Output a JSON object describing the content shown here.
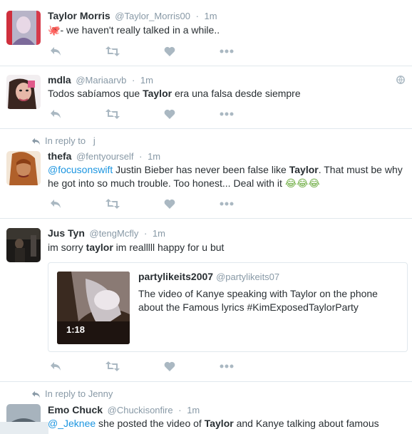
{
  "tweets": [
    {
      "fullname": "Taylor Morris",
      "username": "@Taylor_Morris00",
      "sep": "·",
      "time": "1m",
      "text_emoji": "🐙",
      "text_rest": "- we haven't really talked in a while.."
    },
    {
      "fullname": "mdla",
      "username": "@Mariaarvb",
      "sep": "·",
      "time": "1m",
      "text_a": "Todos sabíamos que ",
      "text_b": "Taylor",
      "text_c": " era una falsa desde siempre"
    },
    {
      "reply_context": "In reply to   j",
      "fullname": "thefa",
      "username": "@fentyourself",
      "sep": "·",
      "time": "1m",
      "mention": "@focusonswift",
      "text_a": " Justin Bieber has never been false like ",
      "text_b": "Taylor",
      "text_c": ". That must be why he got into so much trouble. Too honest... Deal with it ",
      "emoji": "😂😂😂"
    },
    {
      "fullname": "Jus Tyn",
      "username": "@tengMcfly",
      "sep": "·",
      "time": "1m",
      "text_a": "im sorry ",
      "text_b": "taylor",
      "text_c": " im realllll happy for u but",
      "card": {
        "name": "partylikeits2007",
        "username": "@partylikeits07",
        "text": "The video of Kanye speaking with Taylor on the phone about the Famous lyrics #KimExposedTaylorParty",
        "duration": "1:18"
      }
    },
    {
      "reply_context": "In reply to Jenny",
      "fullname": "Emo Chuck",
      "username": "@Chuckisonfire",
      "sep": "·",
      "time": "1m",
      "mention": "@_Jeknee",
      "text_a": " she posted the video of ",
      "text_b": "Taylor",
      "text_c": " and Kanye talking about famous"
    }
  ],
  "icons": {
    "reply": "reply-icon",
    "retweet": "retweet-icon",
    "like": "heart-icon",
    "more": "more-icon",
    "globe": "globe-icon"
  },
  "colors": {
    "link": "#1b95e0",
    "muted": "#8899a6",
    "icon": "#aab8c2",
    "divider": "#e1e8ed"
  }
}
